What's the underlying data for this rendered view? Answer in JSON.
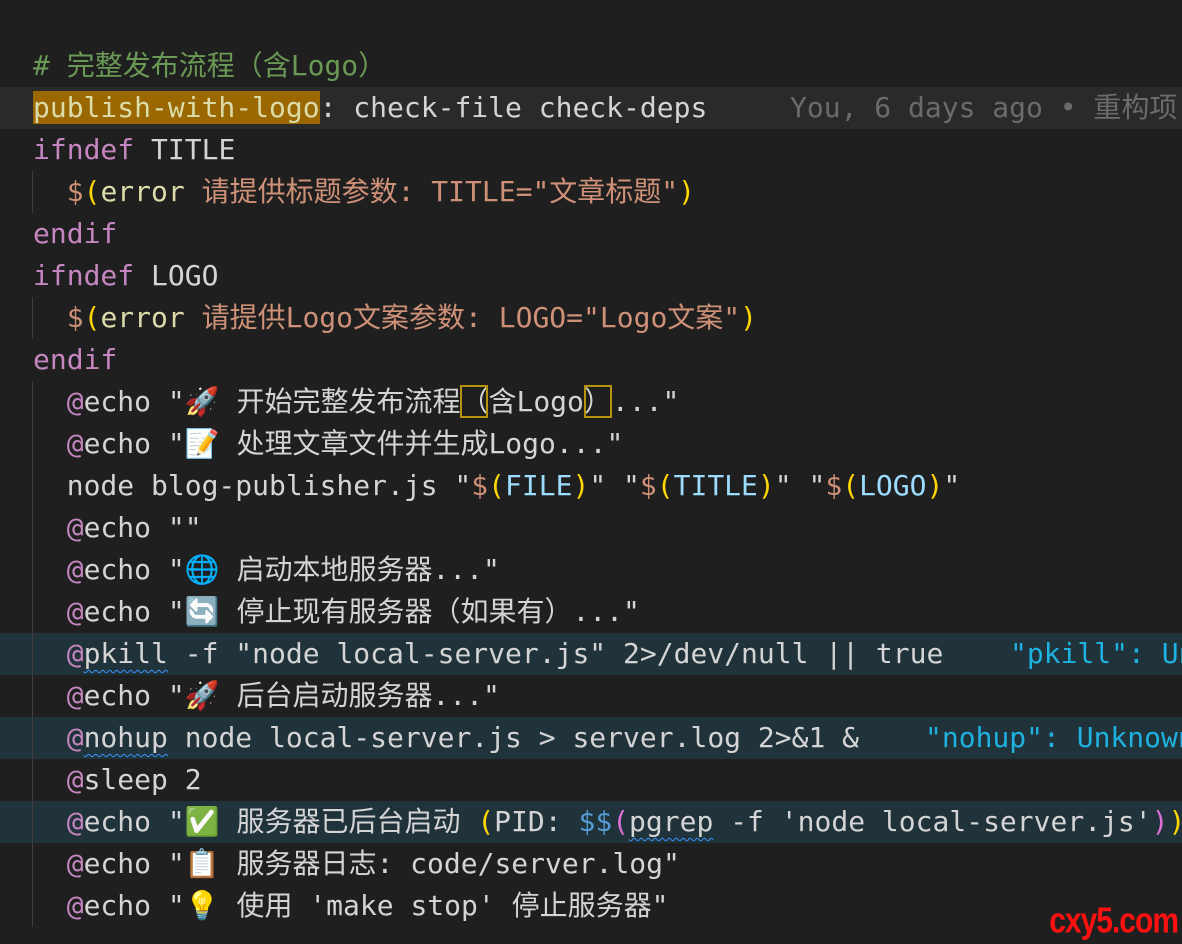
{
  "editor": {
    "lines": [
      {
        "tokens": [
          [
            "# 完整发布流程（含Logo）",
            "comment"
          ]
        ]
      },
      {
        "cur": true,
        "tokens": [
          [
            "publish-with-logo",
            "target"
          ],
          [
            ": check-file check-deps",
            "plain"
          ]
        ],
        "blame": "You, 6 days ago • 重构项"
      },
      {
        "tokens": [
          [
            "ifndef",
            "kw"
          ],
          [
            " TITLE",
            "plain"
          ]
        ]
      },
      {
        "guide": true,
        "tokens": [
          [
            "  ",
            "plain"
          ],
          [
            "$",
            "dollar"
          ],
          [
            "(",
            "paren"
          ],
          [
            "error",
            "func"
          ],
          [
            " 请提供标题参数: TITLE=\"文章标题\"",
            "str"
          ],
          [
            ")",
            "paren"
          ]
        ]
      },
      {
        "tokens": [
          [
            "endif",
            "kw"
          ]
        ]
      },
      {
        "tokens": [
          [
            "ifndef",
            "kw"
          ],
          [
            " LOGO",
            "plain"
          ]
        ]
      },
      {
        "guide": true,
        "tokens": [
          [
            "  ",
            "plain"
          ],
          [
            "$",
            "dollar"
          ],
          [
            "(",
            "paren"
          ],
          [
            "error",
            "func"
          ],
          [
            " 请提供Logo文案参数: LOGO=\"Logo文案\"",
            "str"
          ],
          [
            ")",
            "paren"
          ]
        ]
      },
      {
        "tokens": [
          [
            "endif",
            "kw"
          ]
        ]
      },
      {
        "guide": true,
        "tokens": [
          [
            "  ",
            "plain"
          ],
          [
            "@",
            "at"
          ],
          [
            "echo \"🚀 开始完整发布流程",
            "plain"
          ],
          [
            "（",
            "box"
          ],
          [
            "含Logo",
            "plain"
          ],
          [
            "）",
            "box"
          ],
          [
            "...\"",
            "plain"
          ]
        ]
      },
      {
        "guide": true,
        "tokens": [
          [
            "  ",
            "plain"
          ],
          [
            "@",
            "at"
          ],
          [
            "echo \"📝 处理文章文件并生成Logo...\"",
            "plain"
          ]
        ]
      },
      {
        "guide": true,
        "tokens": [
          [
            "  node blog-publisher.js \"",
            "plain"
          ],
          [
            "$",
            "dollar"
          ],
          [
            "(",
            "paren"
          ],
          [
            "FILE",
            "var"
          ],
          [
            ")",
            "paren"
          ],
          [
            "\" \"",
            "plain"
          ],
          [
            "$",
            "dollar"
          ],
          [
            "(",
            "paren"
          ],
          [
            "TITLE",
            "var"
          ],
          [
            ")",
            "paren"
          ],
          [
            "\" \"",
            "plain"
          ],
          [
            "$",
            "dollar"
          ],
          [
            "(",
            "paren"
          ],
          [
            "LOGO",
            "var"
          ],
          [
            ")",
            "paren"
          ],
          [
            "\"",
            "plain"
          ]
        ]
      },
      {
        "guide": true,
        "tokens": [
          [
            "  ",
            "plain"
          ],
          [
            "@",
            "at"
          ],
          [
            "echo \"\"",
            "plain"
          ]
        ]
      },
      {
        "guide": true,
        "tokens": [
          [
            "  ",
            "plain"
          ],
          [
            "@",
            "at"
          ],
          [
            "echo \"🌐 启动本地服务器...\"",
            "plain"
          ]
        ]
      },
      {
        "guide": true,
        "tokens": [
          [
            "  ",
            "plain"
          ],
          [
            "@",
            "at"
          ],
          [
            "echo \"🔄 停止现有服务器（如果有）...\"",
            "plain"
          ]
        ]
      },
      {
        "guide": true,
        "diag": true,
        "tokens": [
          [
            "  ",
            "plain"
          ],
          [
            "@",
            "at"
          ],
          [
            "pkill",
            "squig"
          ],
          [
            " -f \"node local-server.js\" 2>/dev/null || true",
            "plain"
          ]
        ],
        "diagnostic": "\"pkill\": Un"
      },
      {
        "guide": true,
        "tokens": [
          [
            "  ",
            "plain"
          ],
          [
            "@",
            "at"
          ],
          [
            "echo \"🚀 后台启动服务器...\"",
            "plain"
          ]
        ]
      },
      {
        "guide": true,
        "diag": true,
        "tokens": [
          [
            "  ",
            "plain"
          ],
          [
            "@",
            "at"
          ],
          [
            "nohup",
            "squig"
          ],
          [
            " node local-server.js > server.log 2>&1 &",
            "plain"
          ]
        ],
        "diagnostic": "\"nohup\": Unknown"
      },
      {
        "guide": true,
        "tokens": [
          [
            "  ",
            "plain"
          ],
          [
            "@",
            "at"
          ],
          [
            "sleep 2",
            "plain"
          ]
        ]
      },
      {
        "guide": true,
        "diag": true,
        "tokens": [
          [
            "  ",
            "plain"
          ],
          [
            "@",
            "at"
          ],
          [
            "echo \"✅ 服务器已后台启动 ",
            "plain"
          ],
          [
            "(",
            "paren"
          ],
          [
            "PID: ",
            "plain"
          ],
          [
            "$$",
            "vdollar"
          ],
          [
            "(",
            "paren2"
          ],
          [
            "pgrep",
            "squig"
          ],
          [
            " -f 'node local-server.js'",
            "plain"
          ],
          [
            ")",
            "paren2"
          ],
          [
            ")",
            "paren"
          ],
          [
            "\"",
            "plain"
          ]
        ]
      },
      {
        "guide": true,
        "tokens": [
          [
            "  ",
            "plain"
          ],
          [
            "@",
            "at"
          ],
          [
            "echo \"📋 服务器日志: code/server.log\"",
            "plain"
          ]
        ]
      },
      {
        "guide": true,
        "tokens": [
          [
            "  ",
            "plain"
          ],
          [
            "@",
            "at"
          ],
          [
            "echo \"💡 使用 'make stop' 停止服务器\"",
            "plain"
          ]
        ]
      }
    ]
  },
  "watermark": "cxy5.com",
  "colors": {
    "background": "#1f1f1f",
    "keyword": "#c586c0",
    "string": "#ce9178",
    "variable": "#9cdcfe",
    "comment": "#6a9955",
    "diagnostic": "#1fb1e0"
  }
}
